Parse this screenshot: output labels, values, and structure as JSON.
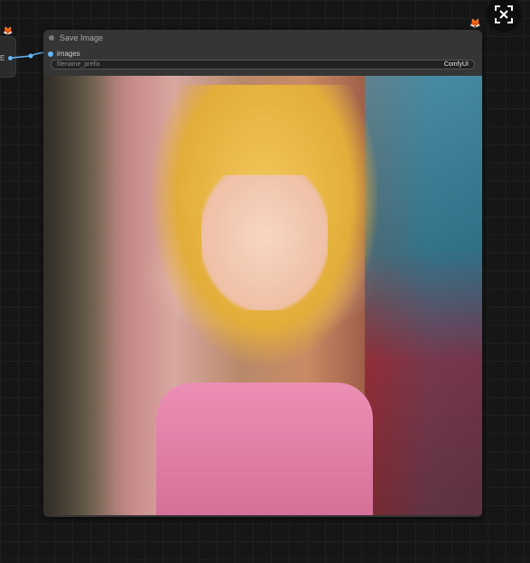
{
  "node": {
    "title": "Save Image",
    "input": {
      "label": "images"
    },
    "widget": {
      "name": "filename_prefix",
      "value": "ComfyUI"
    }
  },
  "previous_node": {
    "output_label": "E"
  },
  "icons": {
    "badge": "fox-badge-icon",
    "fit_view": "fit-view-icon"
  },
  "colors": {
    "canvas": "#161616",
    "node_body": "#353535",
    "link": "#64b5f6",
    "badge": "#e5762f"
  }
}
